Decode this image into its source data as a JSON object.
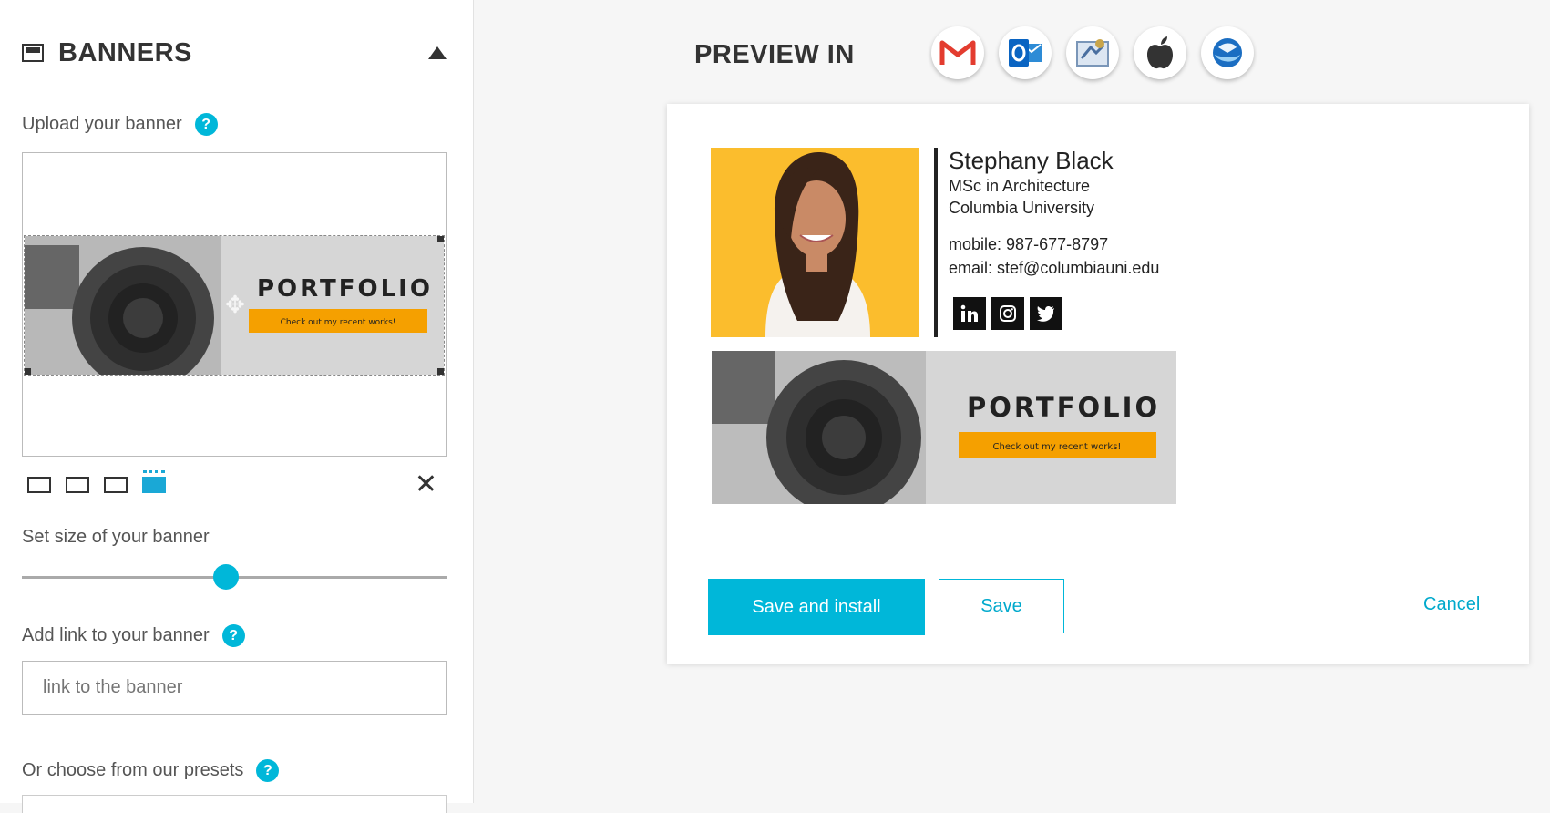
{
  "section": {
    "title": "BANNERS"
  },
  "upload": {
    "label": "Upload your banner",
    "help": "?"
  },
  "banner": {
    "headline": "PORTFOLIO",
    "cta": "Check out my recent works!"
  },
  "size": {
    "label": "Set size of your banner",
    "value_fraction": 0.48
  },
  "link": {
    "label": "Add link to your banner",
    "help": "?",
    "placeholder": "link to the banner"
  },
  "presets": {
    "label": "Or choose from our presets",
    "help": "?"
  },
  "preview": {
    "title": "PREVIEW IN",
    "clients": [
      "gmail-icon",
      "outlook-icon",
      "apple-mail-icon",
      "apple-icon",
      "thunderbird-icon"
    ]
  },
  "signature": {
    "name": "Stephany Black",
    "degree": "MSc in Architecture",
    "university": "Columbia University",
    "mobile_label": "mobile:",
    "mobile": "987-677-8797",
    "email_label": "email:",
    "email": "stef@columbiauni.edu",
    "social": [
      "linkedin-icon",
      "instagram-icon",
      "twitter-icon"
    ]
  },
  "actions": {
    "save_install": "Save and install",
    "save": "Save",
    "cancel": "Cancel"
  },
  "colors": {
    "accent": "#00b7d9",
    "banner_cta": "#f5a000",
    "photo_bg": "#fbbd2d"
  }
}
